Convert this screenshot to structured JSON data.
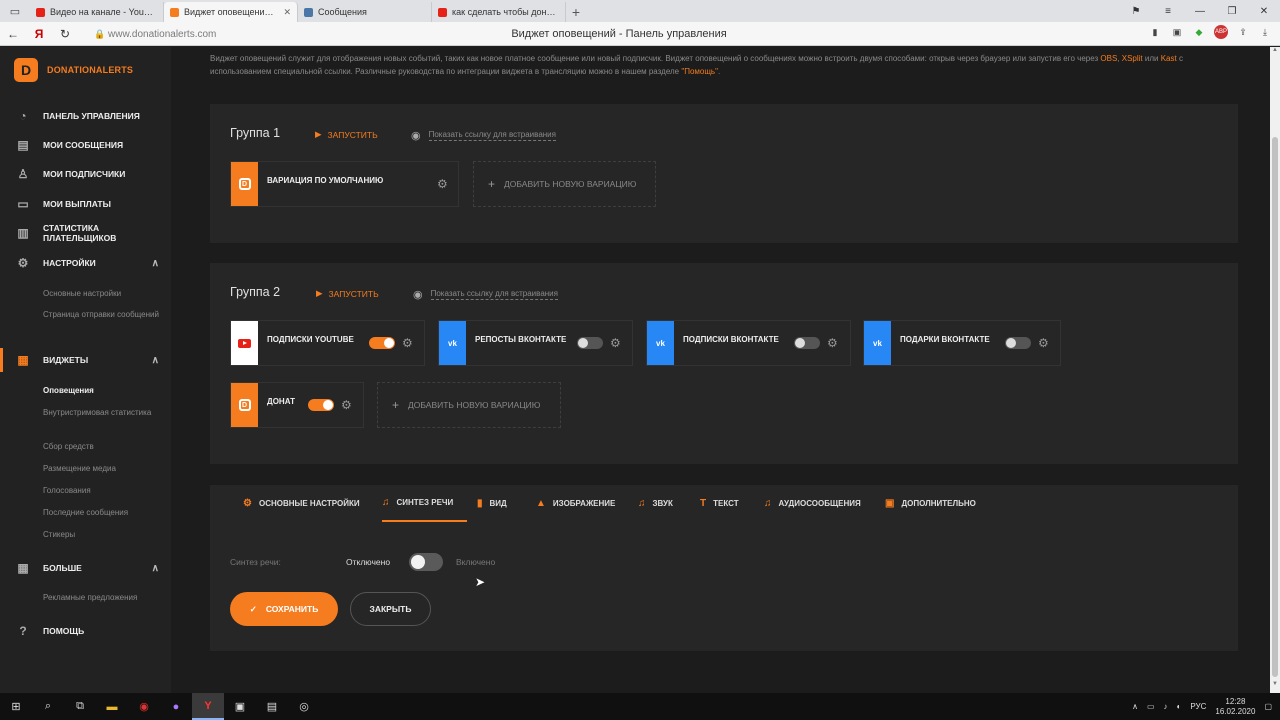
{
  "browser": {
    "tabs": [
      {
        "title": "Видео на канале - YouTube",
        "favicon_color": "#e62117",
        "active": false
      },
      {
        "title": "Виджет оповещений - Панель",
        "favicon_color": "#f57c1f",
        "active": true
      },
      {
        "title": "Сообщения",
        "favicon_color": "#4a76a8",
        "active": false
      },
      {
        "title": "как сделать чтобы донаты",
        "favicon_color": "#e62117",
        "active": false
      }
    ],
    "new_tab": "+",
    "url": "www.donationalerts.com",
    "page_title": "Виджет оповещений - Панель управления",
    "ext_abp": "ABP"
  },
  "sidebar": {
    "logo_text": "DONATIONALERTS",
    "items": [
      {
        "label": "ПАНЕЛЬ УПРАВЛЕНИЯ",
        "icon": "dashboard-icon"
      },
      {
        "label": "МОИ СООБЩЕНИЯ",
        "icon": "messages-icon"
      },
      {
        "label": "МОИ ПОДПИСЧИКИ",
        "icon": "user-icon"
      },
      {
        "label": "МОИ ВЫПЛАТЫ",
        "icon": "wallet-icon"
      },
      {
        "label": "СТАТИСТИКА ПЛАТЕЛЬЩИКОВ",
        "icon": "stats-icon"
      },
      {
        "label": "НАСТРОЙКИ",
        "icon": "gear-icon"
      },
      {
        "label": "ВИДЖЕТЫ",
        "icon": "widgets-icon"
      },
      {
        "label": "БОЛЬШЕ",
        "icon": "more-icon"
      },
      {
        "label": "ПОМОЩЬ",
        "icon": "help-icon"
      }
    ],
    "settings_sub": [
      "Основные настройки",
      "Страница отправки сообщений"
    ],
    "widgets_sub": [
      "Оповещения",
      "Внутристримовая статистика",
      "Сбор средств",
      "Размещение медиа",
      "Голосования",
      "Последние сообщения",
      "Стикеры"
    ],
    "more_sub": [
      "Рекламные предложения"
    ]
  },
  "intro": {
    "text1": "Виджет оповещений служит для отображения новых событий, таких как новое платное сообщение или новый подписчик. Виджет оповещений о сообщениях можно встроить двумя способами: открыв через браузер или запустив его через ",
    "link_obs": "OBS",
    "text2": ", ",
    "link_xsplit": "XSplit",
    "text3": " или ",
    "link_kast": "Kast",
    "text4": " с использованием специальной ссылки. Различные руководства по интеграции виджета в трансляцию можно в нашем разделе ",
    "link_help": "\"Помощь\"",
    "text5": "."
  },
  "group1": {
    "title": "Группа 1",
    "launch": "ЗАПУСТИТЬ",
    "show_link": "Показать ссылку для встраивания",
    "variation": "ВАРИАЦИЯ ПО УМОЛЧАНИЮ",
    "add_variation": "ДОБАВИТЬ НОВУЮ ВАРИАЦИЮ"
  },
  "group2": {
    "title": "Группа 2",
    "launch": "ЗАПУСТИТЬ",
    "show_link": "Показать ссылку для встраивания",
    "cards": [
      {
        "label": "ПОДПИСКИ YOUTUBE",
        "enabled": true
      },
      {
        "label": "РЕПОСТЫ ВКОНТАКТЕ",
        "enabled": false
      },
      {
        "label": "ПОДПИСКИ ВКОНТАКТЕ",
        "enabled": false
      },
      {
        "label": "ПОДАРКИ ВКОНТАКТЕ",
        "enabled": false
      },
      {
        "label": "ДОНАТ",
        "enabled": true
      }
    ],
    "vk_text": "vk",
    "add_variation": "ДОБАВИТЬ НОВУЮ ВАРИАЦИЮ"
  },
  "settings": {
    "tabs": [
      "ОСНОВНЫЕ НАСТРОЙКИ",
      "СИНТЕЗ РЕЧИ",
      "ВИД",
      "ИЗОБРАЖЕНИЕ",
      "ЗВУК",
      "ТЕКСТ",
      "АУДИОСООБЩЕНИЯ",
      "ДОПОЛНИТЕЛЬНО"
    ],
    "active_tab": "СИНТЕЗ РЕЧИ",
    "tts_label": "Синтез речи:",
    "off_label": "Отключено",
    "on_label": "Включено",
    "tts_enabled": false,
    "save": "СОХРАНИТЬ",
    "close": "ЗАКРЫТЬ"
  },
  "taskbar": {
    "lang": "РУС",
    "time": "12:28",
    "date": "16.02.2020"
  },
  "colors": {
    "accent": "#f57c1f",
    "vk": "#2787f5",
    "youtube": "#e62117"
  }
}
